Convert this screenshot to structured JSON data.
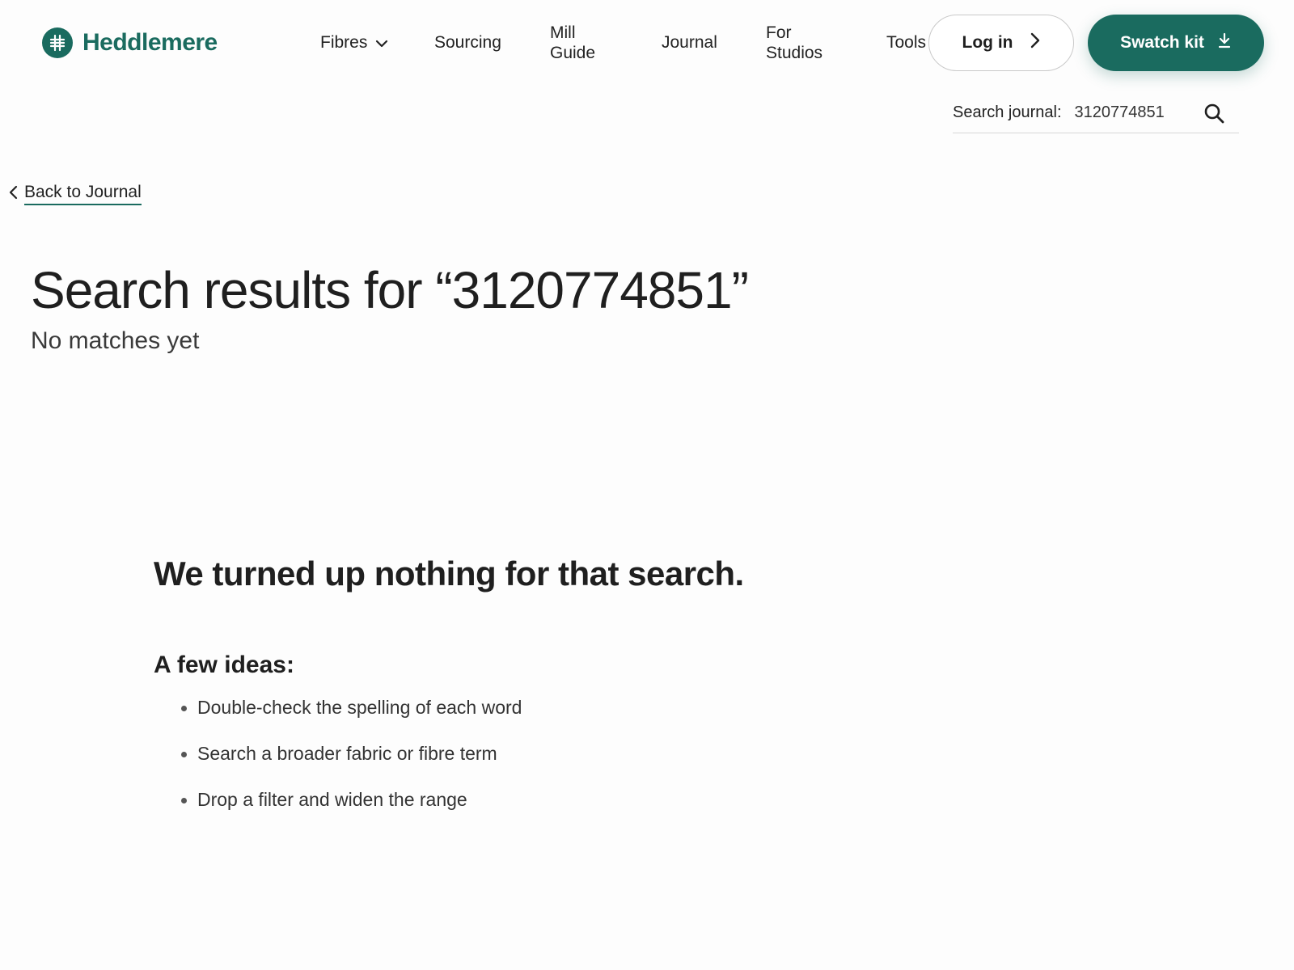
{
  "brand": {
    "name": "Heddlemere",
    "accent": "#1a6b5f"
  },
  "nav": {
    "fibres": "Fibres",
    "sourcing": "Sourcing",
    "mill_guide": "Mill Guide",
    "journal": "Journal",
    "for_studios": "For Studios",
    "tools": "Tools"
  },
  "actions": {
    "login_label": "Log in",
    "swatch_label": "Swatch kit"
  },
  "search": {
    "label": "Search journal:",
    "value": "3120774851"
  },
  "back_link": "Back to Journal",
  "results": {
    "title": "Search results for “3120774851”",
    "subtitle": "No matches yet"
  },
  "empty_state": {
    "heading": "We turned up nothing for that search.",
    "ideas_heading": "A few ideas:",
    "ideas": [
      "Double-check the spelling of each word",
      "Search a broader fabric or fibre term",
      "Drop a filter and widen the range"
    ]
  }
}
